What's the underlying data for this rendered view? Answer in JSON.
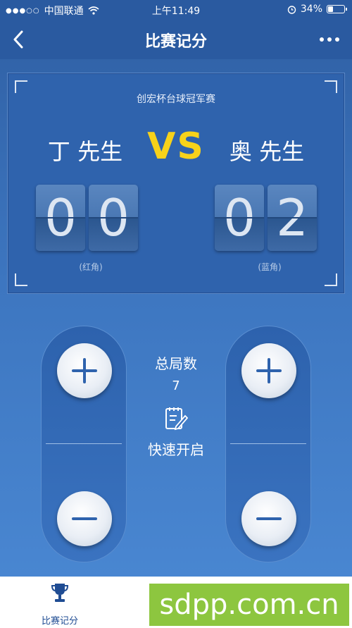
{
  "status_bar": {
    "carrier": "中国联通",
    "time": "上午11:49",
    "battery": "34%",
    "battery_level": 0.34
  },
  "nav": {
    "title": "比赛记分",
    "back_icon": "chevron-left-icon",
    "more_icon": "more-dots-icon"
  },
  "scoreboard": {
    "match_title": "创宏杯台球冠军赛",
    "vs": "VS",
    "left_player": {
      "name": "丁 先生",
      "score_digits": [
        "0",
        "0"
      ],
      "side_label": "(红角)"
    },
    "right_player": {
      "name": "奥 先生",
      "score_digits": [
        "0",
        "2"
      ],
      "side_label": "(蓝角)"
    }
  },
  "controls": {
    "total_rounds_label": "总局数",
    "total_rounds_value": "7",
    "quick_start_label": "快速开启",
    "plus_icon": "plus-icon",
    "minus_icon": "minus-icon"
  },
  "tab_bar": {
    "items": [
      {
        "label": "比赛记分",
        "icon": "trophy-icon"
      }
    ]
  },
  "watermark": "sdpp.com.cn",
  "colors": {
    "accent_vs": "#f7d21a",
    "header": "#2a5aa0",
    "watermark_bg": "#8dc63f"
  }
}
